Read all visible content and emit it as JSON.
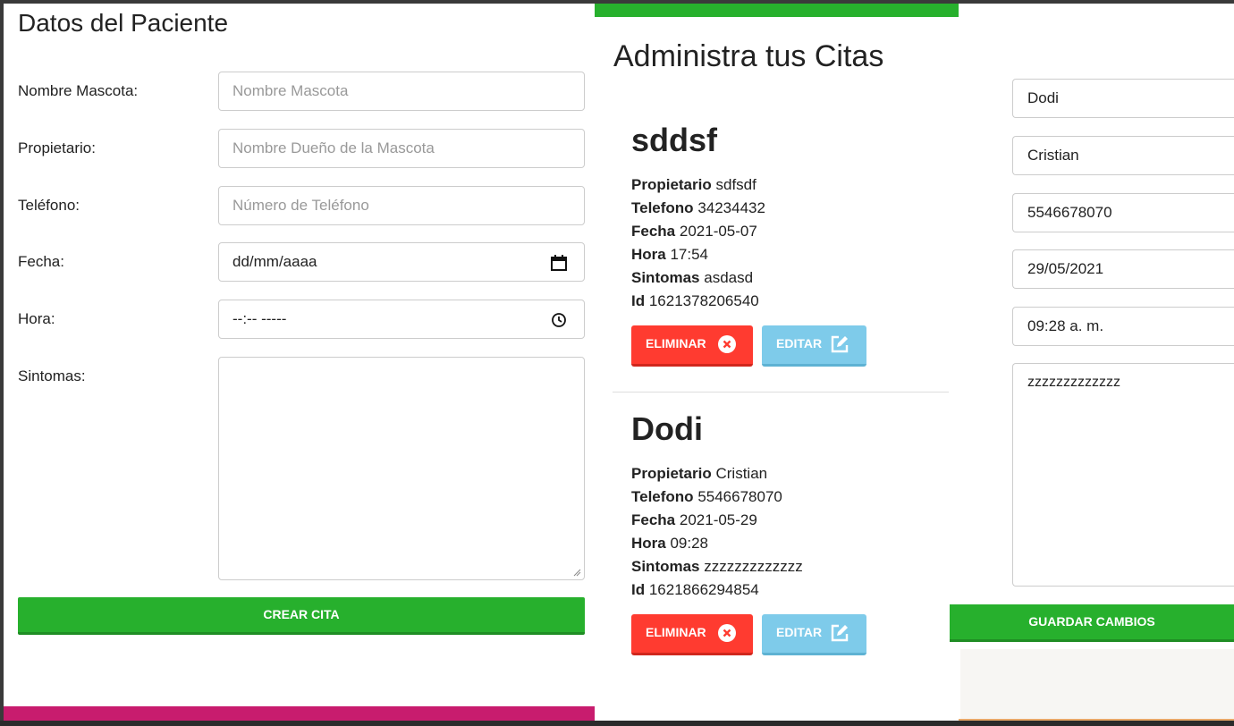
{
  "form": {
    "title": "Datos del Paciente",
    "fields": [
      {
        "label": "Nombre Mascota:",
        "placeholder": "Nombre Mascota"
      },
      {
        "label": "Propietario:",
        "placeholder": "Nombre Dueño de la Mascota"
      },
      {
        "label": "Teléfono:",
        "placeholder": "Número de Teléfono"
      },
      {
        "label": "Fecha:",
        "value": "dd/mm/aaaa"
      },
      {
        "label": "Hora:",
        "value": "--:-- -----"
      },
      {
        "label": "Sintomas:"
      }
    ],
    "submit_label": "CREAR CITA"
  },
  "citas": {
    "title": "Administra tus Citas",
    "field_labels": {
      "propietario": "Propietario",
      "telefono": "Telefono",
      "fecha": "Fecha",
      "hora": "Hora",
      "sintomas": "Sintomas",
      "id": "Id"
    },
    "delete_label": "ELIMINAR",
    "edit_label": "EDITAR",
    "items": [
      {
        "nombre": "sddsf",
        "propietario": "sdfsdf",
        "telefono": "34234432",
        "fecha": "2021-05-07",
        "hora": "17:54",
        "sintomas": "asdasd",
        "id": "1621378206540"
      },
      {
        "nombre": "Dodi",
        "propietario": "Cristian",
        "telefono": "5546678070",
        "fecha": "2021-05-29",
        "hora": "09:28",
        "sintomas": "zzzzzzzzzzzzz",
        "id": "1621866294854"
      }
    ]
  },
  "edit_form": {
    "values": [
      "Dodi",
      "Cristian",
      "5546678070",
      "29/05/2021",
      "09:28 a. m."
    ],
    "sintomas": "zzzzzzzzzzzzz",
    "save_label": "GUARDAR CAMBIOS"
  },
  "colors": {
    "green": "#27b02d",
    "red": "#ff3b30",
    "light_blue": "#7ecbea",
    "pink": "#c81c6e"
  }
}
